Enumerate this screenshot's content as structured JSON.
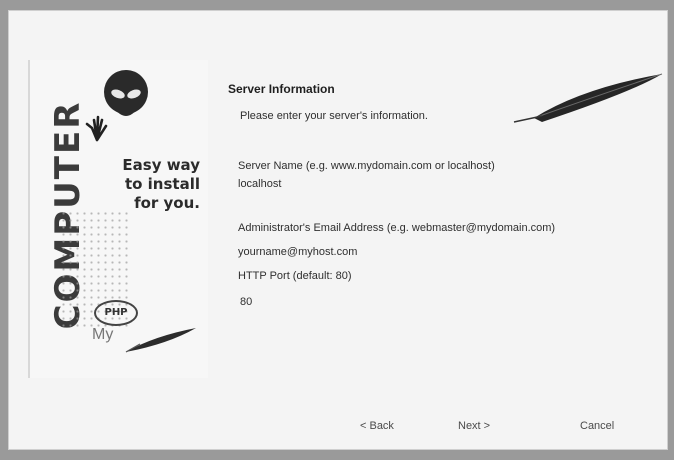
{
  "banner": {
    "vertical_brand": "COMPUTER",
    "tagline": [
      "Easy way",
      "to install",
      "for you."
    ],
    "php_badge": "PHP",
    "mysql_text": "My"
  },
  "page": {
    "title": "Server Information",
    "subtitle": "Please enter your server's information."
  },
  "fields": {
    "server_name": {
      "label": "Server Name (e.g. www.mydomain.com or localhost)",
      "value": "localhost"
    },
    "admin_email": {
      "label": "Administrator's Email Address (e.g. webmaster@mydomain.com)",
      "value": "yourname@myhost.com"
    },
    "http_port": {
      "label": "HTTP Port (default: 80)",
      "value": "80"
    }
  },
  "buttons": {
    "back": "< Back",
    "next": "Next >",
    "cancel": "Cancel"
  },
  "icons": {
    "alien_logo": "alien-head-icon",
    "hand": "hand-icon",
    "feather": "feather-icon",
    "small_feather": "feather-icon"
  }
}
